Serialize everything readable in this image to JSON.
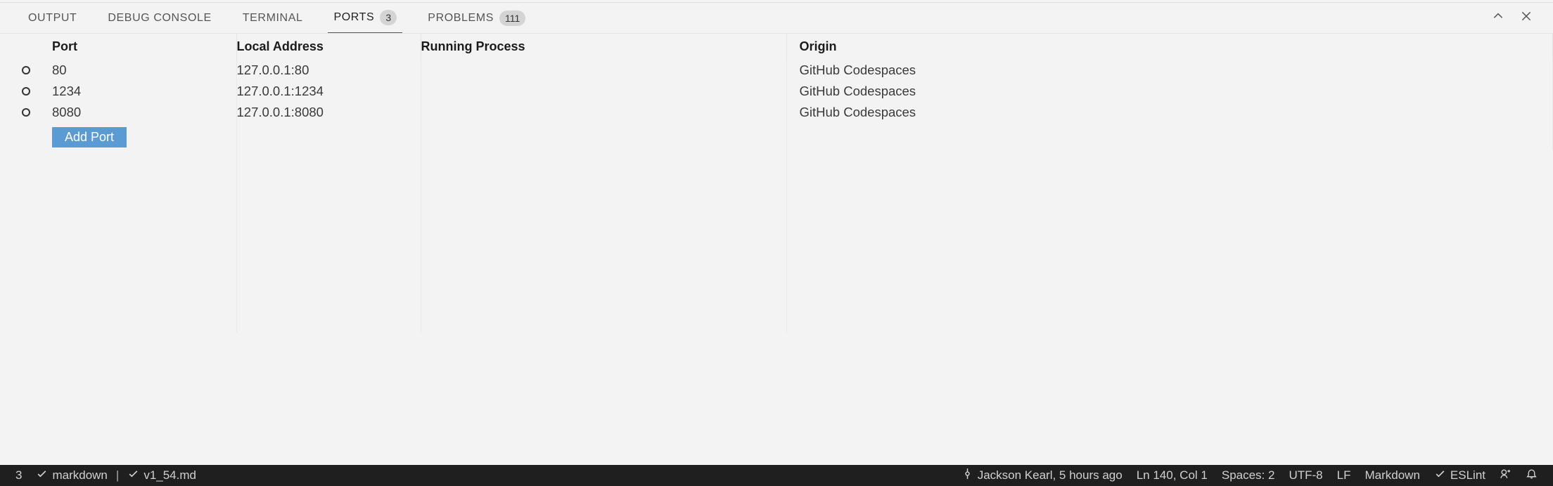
{
  "panelTabs": {
    "output": "OUTPUT",
    "debugConsole": "DEBUG CONSOLE",
    "terminal": "TERMINAL",
    "ports": "PORTS",
    "portsBadge": "3",
    "problems": "PROBLEMS",
    "problemsBadge": "111"
  },
  "ports": {
    "headers": {
      "port": "Port",
      "localAddress": "Local Address",
      "runningProcess": "Running Process",
      "origin": "Origin"
    },
    "rows": [
      {
        "port": "80",
        "address": "127.0.0.1:80",
        "process": "",
        "origin": "GitHub Codespaces"
      },
      {
        "port": "1234",
        "address": "127.0.0.1:1234",
        "process": "",
        "origin": "GitHub Codespaces"
      },
      {
        "port": "8080",
        "address": "127.0.0.1:8080",
        "process": "",
        "origin": "GitHub Codespaces"
      }
    ],
    "addPortLabel": "Add Port"
  },
  "statusbar": {
    "errorCount": "3",
    "lang1": "markdown",
    "file": "v1_54.md",
    "blame": "Jackson Kearl, 5 hours ago",
    "cursor": "Ln 140, Col 1",
    "spaces": "Spaces: 2",
    "encoding": "UTF-8",
    "eol": "LF",
    "langMode": "Markdown",
    "eslint": "ESLint"
  }
}
